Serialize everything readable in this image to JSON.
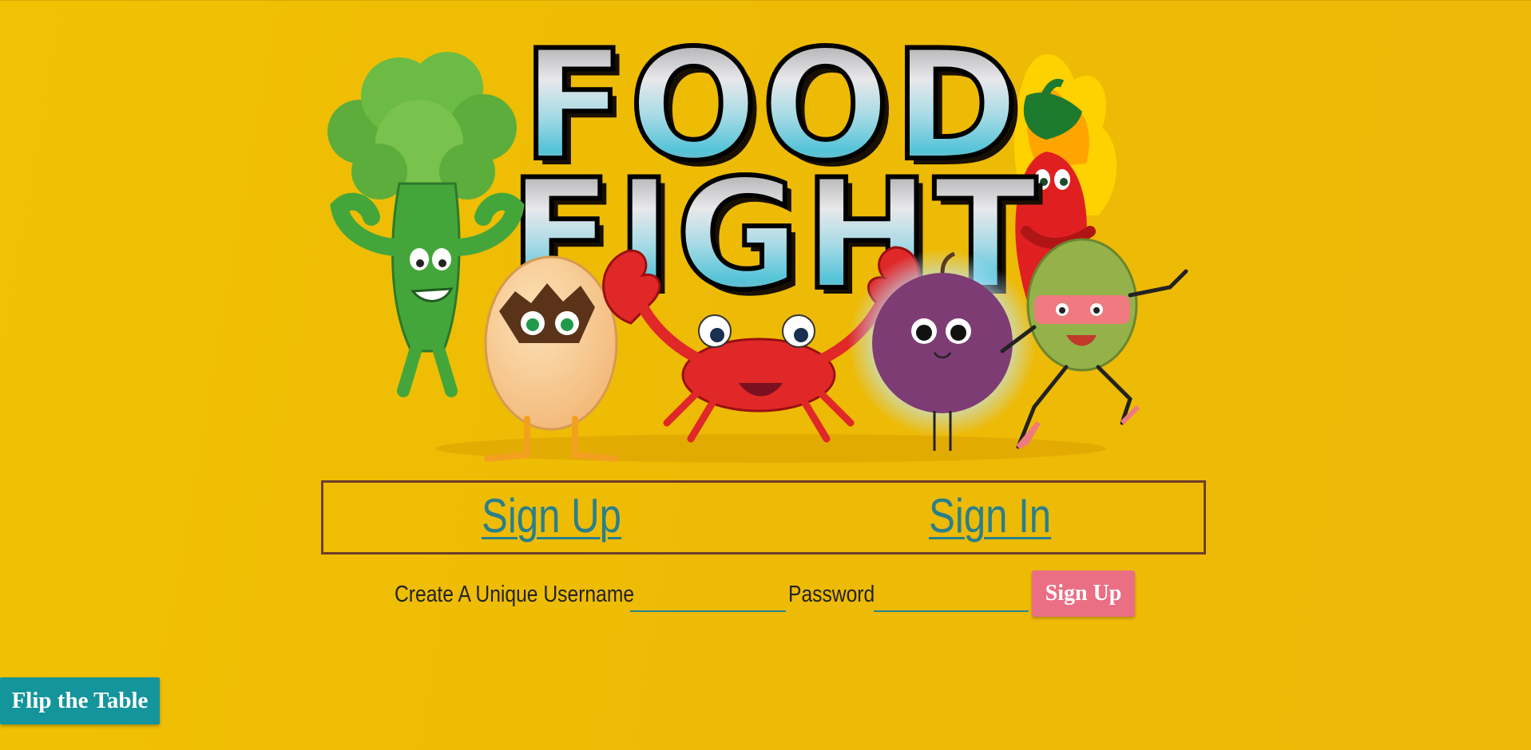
{
  "hero": {
    "logo_line1": "FOOD",
    "logo_line2": "FIGHT",
    "characters": [
      "broccoli-character",
      "egg-character",
      "crab-character",
      "plum-character",
      "olive-character",
      "chili-pepper-character"
    ]
  },
  "auth_tabs": {
    "signup_label": "Sign Up",
    "signin_label": "Sign In"
  },
  "form": {
    "username_label": "Create A Unique Username",
    "username_value": "",
    "password_label": "Password",
    "password_value": "",
    "submit_label": "Sign Up"
  },
  "flip_button": {
    "label": "Flip the Table"
  },
  "colors": {
    "background": "#EEBB04",
    "tab_link": "#2A7F8C",
    "tab_border": "#6B3F2A",
    "submit_button": "#EA6F84",
    "flip_button": "#14959B",
    "input_underline": "#27888F"
  }
}
